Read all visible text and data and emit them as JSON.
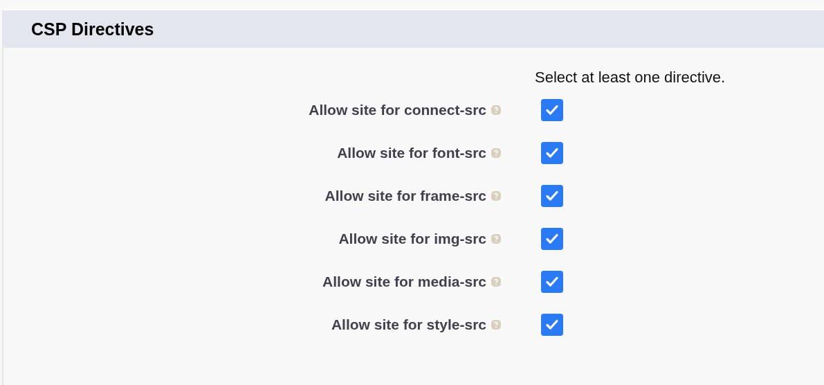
{
  "section": {
    "title": "CSP Directives"
  },
  "hint": "Select at least one directive.",
  "directives": [
    {
      "label": "Allow site for connect-src",
      "checked": true
    },
    {
      "label": "Allow site for font-src",
      "checked": true
    },
    {
      "label": "Allow site for frame-src",
      "checked": true
    },
    {
      "label": "Allow site for img-src",
      "checked": true
    },
    {
      "label": "Allow site for media-src",
      "checked": true
    },
    {
      "label": "Allow site for style-src",
      "checked": true
    }
  ]
}
